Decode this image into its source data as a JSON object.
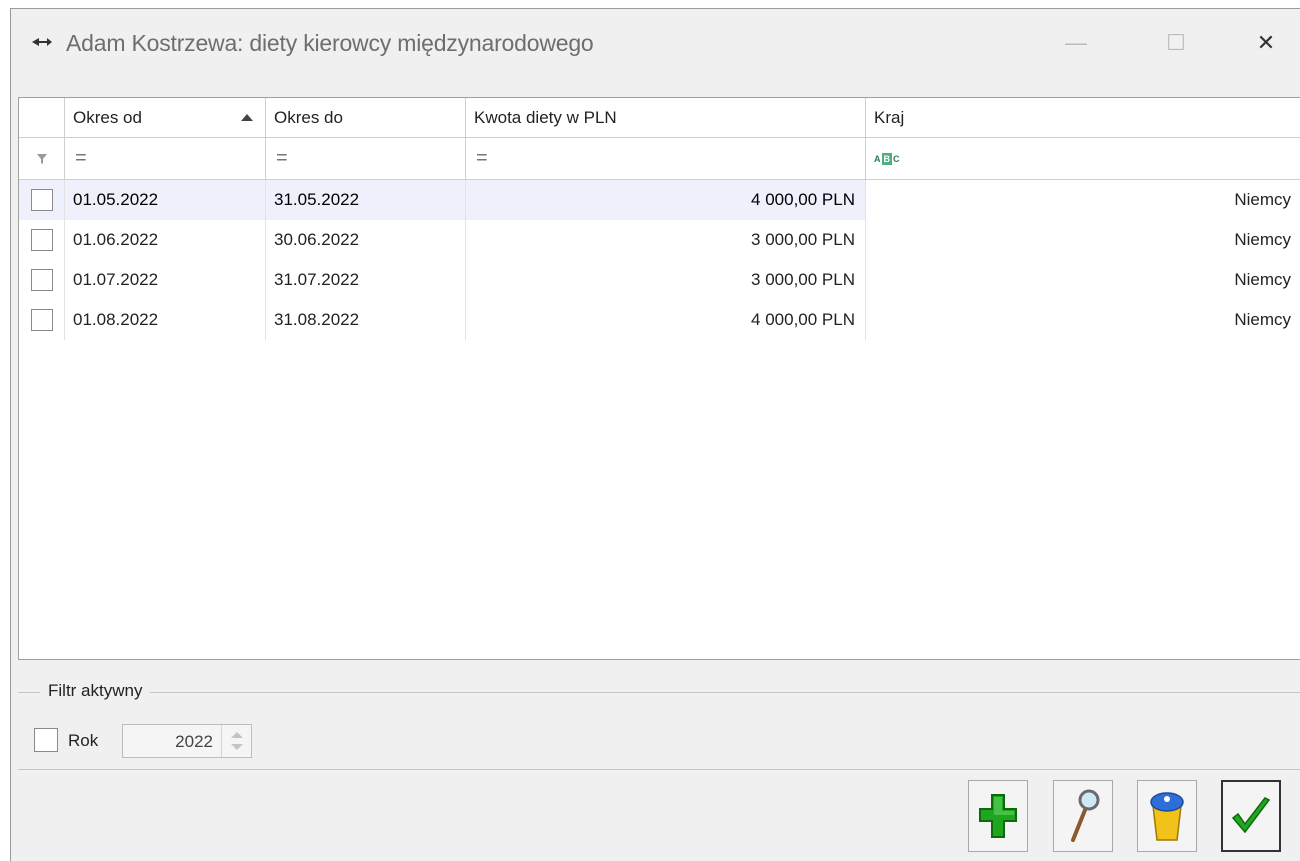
{
  "window": {
    "title": "Adam Kostrzewa: diety kierowcy międzynarodowego",
    "minimize_glyph": "—",
    "maximize_glyph": "☐",
    "close_glyph": "✕"
  },
  "grid": {
    "columns": [
      "Okres od",
      "Okres do",
      "Kwota diety w PLN",
      "Kraj"
    ],
    "sort_column": "Okres od",
    "sort_direction": "ascending",
    "filter_row": {
      "okres_od": "=",
      "okres_do": "=",
      "kwota": "=",
      "kraj_icon": "abc-text-filter-icon"
    },
    "rows": [
      {
        "okres_od": "01.05.2022",
        "okres_do": "31.05.2022",
        "kwota": "4 000,00 PLN",
        "kraj": "Niemcy",
        "selected": true
      },
      {
        "okres_od": "01.06.2022",
        "okres_do": "30.06.2022",
        "kwota": "3 000,00 PLN",
        "kraj": "Niemcy",
        "selected": false
      },
      {
        "okres_od": "01.07.2022",
        "okres_do": "31.07.2022",
        "kwota": "3 000,00 PLN",
        "kraj": "Niemcy",
        "selected": false
      },
      {
        "okres_od": "01.08.2022",
        "okres_do": "31.08.2022",
        "kwota": "4 000,00 PLN",
        "kraj": "Niemcy",
        "selected": false
      }
    ]
  },
  "filter": {
    "legend": "Filtr aktywny",
    "rok_label": "Rok",
    "rok_checked": false,
    "rok_value": "2022"
  },
  "buttons": {
    "add_icon": "green-plus-icon",
    "view_icon": "magnifier-icon",
    "delete_icon": "trash-bin-icon",
    "ok_icon": "green-checkmark-icon"
  },
  "colors": {
    "selected_row": "#eef1fb",
    "plus_green": "#1fa51f",
    "check_green": "#22a722"
  }
}
